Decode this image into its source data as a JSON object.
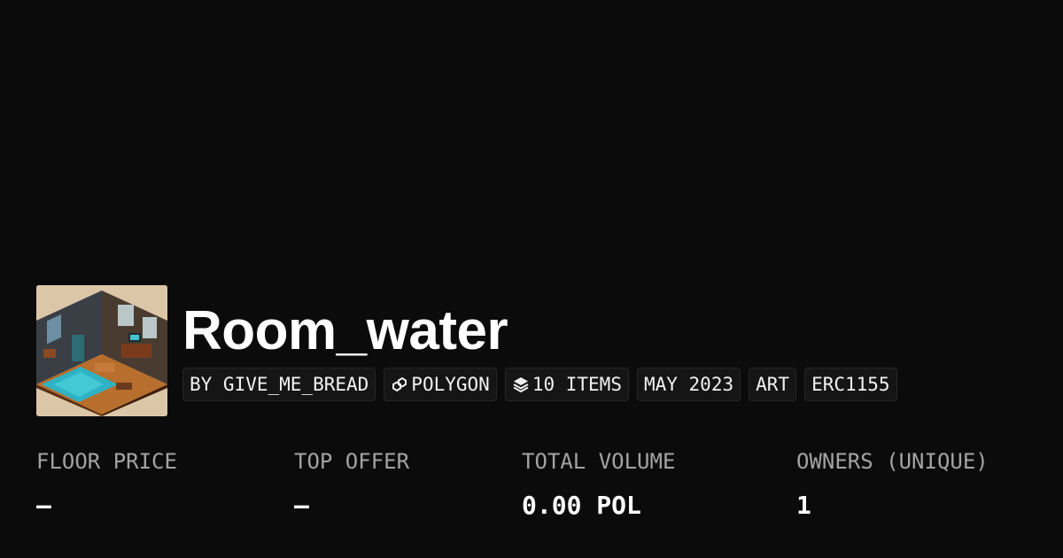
{
  "collection": {
    "title": "Room_water",
    "thumbnail_icon": "isometric-room-pixel-art"
  },
  "chips": [
    {
      "label": "BY GIVE_ME_BREAD",
      "icon": ""
    },
    {
      "label": "POLYGON",
      "icon": "polygon-chain-icon"
    },
    {
      "label": "10 ITEMS",
      "icon": "layers-icon"
    },
    {
      "label": "MAY 2023",
      "icon": ""
    },
    {
      "label": "ART",
      "icon": ""
    },
    {
      "label": "ERC1155",
      "icon": ""
    }
  ],
  "stats": [
    {
      "label": "FLOOR PRICE",
      "value": "–"
    },
    {
      "label": "TOP OFFER",
      "value": "–"
    },
    {
      "label": "TOTAL VOLUME",
      "value": "0.00 POL"
    },
    {
      "label": "OWNERS (UNIQUE)",
      "value": "1"
    }
  ],
  "colors": {
    "background": "#0b0b0b",
    "chip_background": "#151515",
    "label_gray": "#a3a3a3"
  }
}
